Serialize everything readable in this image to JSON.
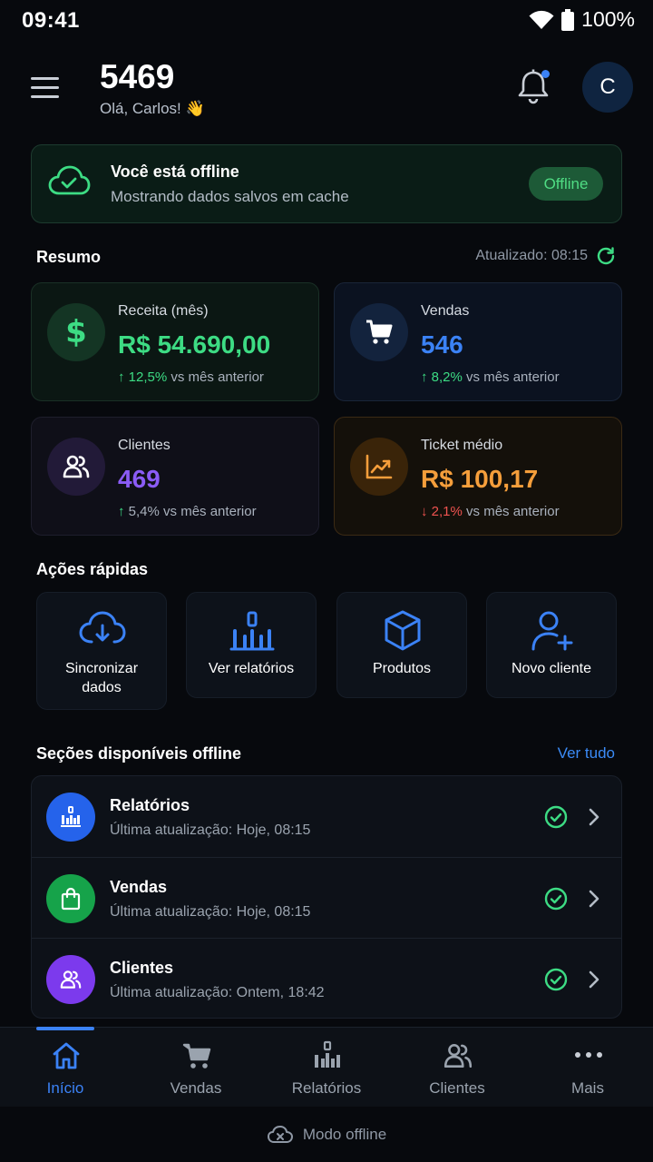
{
  "status_bar": {
    "time": "09:41",
    "battery": "100%"
  },
  "header": {
    "title": "5469",
    "greeting": "Olá, Carlos! 👋",
    "avatar_initial": "C"
  },
  "offline_banner": {
    "title": "Você está offline",
    "subtitle": "Mostrando dados salvos em cache",
    "badge": "Offline"
  },
  "summary": {
    "heading": "Resumo",
    "updated": "Atualizado: 08:15",
    "cards": [
      {
        "label": "Receita (mês)",
        "value": "R$ 54.690,00",
        "change": "12,5%",
        "change_suffix": "vs mês anterior",
        "direction": "up",
        "color": "#3ddc84",
        "icon": "dollar-icon"
      },
      {
        "label": "Vendas",
        "value": "546",
        "change": "8,2%",
        "change_suffix": "vs mês anterior",
        "direction": "up",
        "color": "#3b82f6",
        "icon": "cart-icon"
      },
      {
        "label": "Clientes",
        "value": "469",
        "change": "5,4%",
        "change_suffix": "vs mês anterior",
        "direction": "up",
        "color": "#8b5cf6",
        "icon": "users-icon"
      },
      {
        "label": "Ticket médio",
        "value": "R$ 100,17",
        "change": "2,1%",
        "change_suffix": "vs mês anterior",
        "direction": "down",
        "color": "#f59e3b",
        "icon": "trend-up-icon"
      }
    ]
  },
  "quick_actions": {
    "heading": "Ações rápidas",
    "items": [
      {
        "label_line1": "Sincronizar",
        "label_line2": "dados",
        "icon": "cloud-download-icon"
      },
      {
        "label_line1": "Ver relatórios",
        "label_line2": "",
        "icon": "bar-chart-icon"
      },
      {
        "label_line1": "Produtos",
        "label_line2": "",
        "icon": "box-icon"
      },
      {
        "label_line1": "Novo cliente",
        "label_line2": "",
        "icon": "user-plus-icon"
      }
    ]
  },
  "offline_sections": {
    "heading": "Seções disponíveis offline",
    "see_all": "Ver tudo",
    "items": [
      {
        "title": "Relatórios",
        "subtitle": "Última atualização: Hoje, 08:15",
        "icon": "bar-chart-icon",
        "color": "#2563eb"
      },
      {
        "title": "Vendas",
        "subtitle": "Última atualização: Hoje, 08:15",
        "icon": "bag-icon",
        "color": "#16a34a"
      },
      {
        "title": "Clientes",
        "subtitle": "Última atualização: Ontem, 18:42",
        "icon": "users-icon",
        "color": "#7c3aed"
      }
    ]
  },
  "bottom_nav": {
    "items": [
      {
        "label": "Início",
        "icon": "home-icon",
        "active": true
      },
      {
        "label": "Vendas",
        "icon": "cart-icon",
        "active": false
      },
      {
        "label": "Relatórios",
        "icon": "bar-chart-icon",
        "active": false
      },
      {
        "label": "Clientes",
        "icon": "users-icon",
        "active": false
      },
      {
        "label": "Mais",
        "icon": "more-icon",
        "active": false
      }
    ]
  },
  "footer": {
    "label": "Modo offline"
  },
  "colors": {
    "accent": "#3b82f6",
    "success": "#3ddc84",
    "danger": "#ef5350",
    "background": "#07090d"
  }
}
